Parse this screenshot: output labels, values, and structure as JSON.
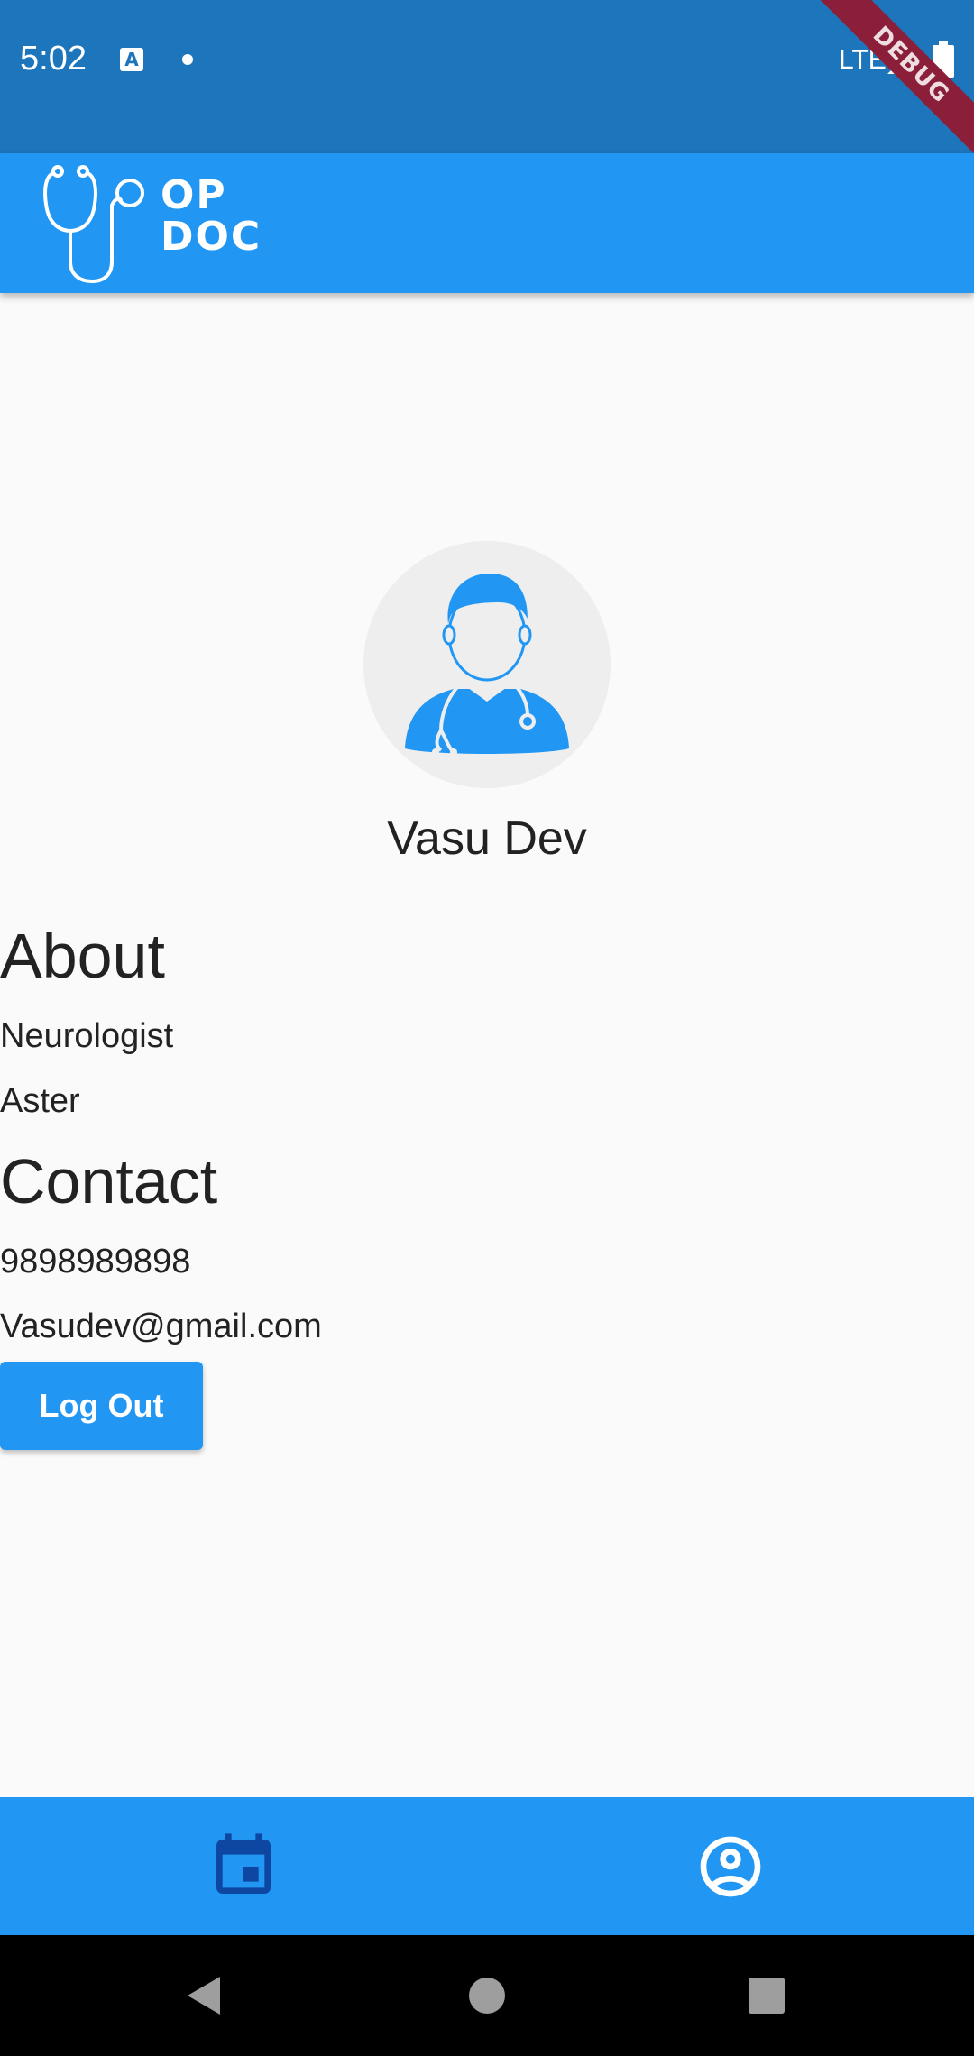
{
  "status_bar": {
    "time": "5:02",
    "network": "LTE",
    "debug_label": "DEBUG"
  },
  "app_bar": {
    "logo_line1": "OP",
    "logo_line2": "DOC"
  },
  "profile": {
    "name": "Vasu Dev"
  },
  "about": {
    "heading": "About",
    "specialty": "Neurologist",
    "hospital": "Aster"
  },
  "contact": {
    "heading": "Contact",
    "phone": "9898989898",
    "email": "Vasudev@gmail.com"
  },
  "actions": {
    "logout_label": "Log Out"
  },
  "bottom_nav": {
    "items": [
      {
        "icon": "calendar-icon",
        "active": true
      },
      {
        "icon": "account-circle-icon",
        "active": false
      }
    ]
  },
  "colors": {
    "primary": "#2196F3",
    "status_bar": "#1D75BB",
    "active_nav_icon": "#0D47A1",
    "background": "#FAFAFA"
  }
}
